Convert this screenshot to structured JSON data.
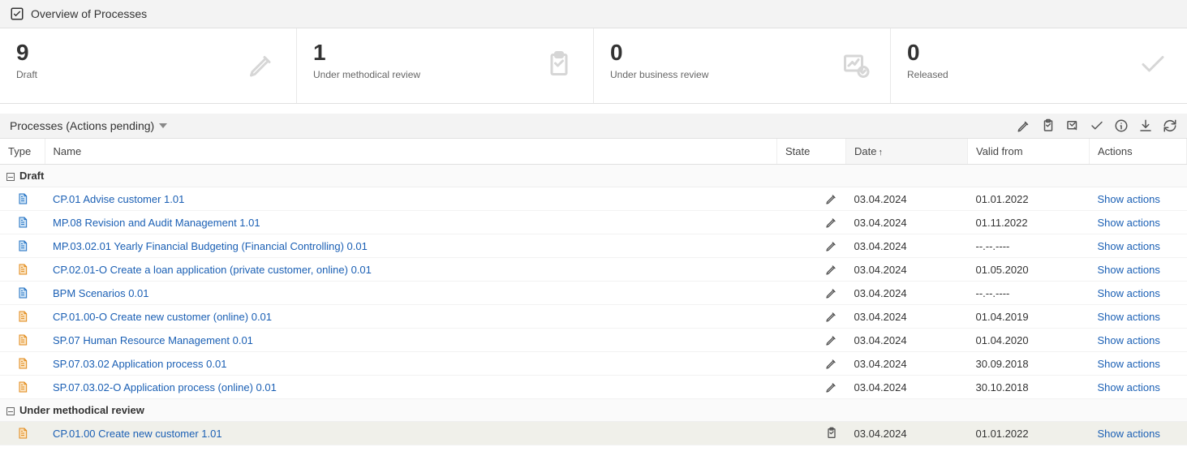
{
  "header": {
    "title": "Overview of Processes"
  },
  "cards": [
    {
      "count": "9",
      "label": "Draft",
      "icon": "pencil"
    },
    {
      "count": "1",
      "label": "Under methodical review",
      "icon": "clipboard"
    },
    {
      "count": "0",
      "label": "Under business review",
      "icon": "chart-check"
    },
    {
      "count": "0",
      "label": "Released",
      "icon": "check"
    }
  ],
  "section": {
    "title": "Processes (Actions pending)"
  },
  "toolbar_icons": [
    "pencil",
    "clipboard",
    "stamp",
    "check",
    "info",
    "download",
    "refresh"
  ],
  "columns": {
    "type": "Type",
    "name": "Name",
    "state": "State",
    "date": "Date",
    "date_sort": "↑",
    "valid_from": "Valid from",
    "actions": "Actions"
  },
  "groups": [
    {
      "label": "Draft",
      "rows": [
        {
          "type": "blue",
          "name": "CP.01 Advise customer 1.01",
          "state": "pencil",
          "date": "03.04.2024",
          "valid_from": "01.01.2022",
          "action": "Show actions"
        },
        {
          "type": "blue",
          "name": "MP.08 Revision and Audit Management 1.01",
          "state": "pencil",
          "date": "03.04.2024",
          "valid_from": "01.11.2022",
          "action": "Show actions"
        },
        {
          "type": "blue",
          "name": "MP.03.02.01 Yearly Financial Budgeting (Financial Controlling) 0.01",
          "state": "pencil",
          "date": "03.04.2024",
          "valid_from": "--.--.----",
          "action": "Show actions"
        },
        {
          "type": "orange",
          "name": "CP.02.01-O Create a loan application (private customer, online) 0.01",
          "state": "pencil",
          "date": "03.04.2024",
          "valid_from": "01.05.2020",
          "action": "Show actions"
        },
        {
          "type": "blue",
          "name": "BPM Scenarios 0.01",
          "state": "pencil",
          "date": "03.04.2024",
          "valid_from": "--.--.----",
          "action": "Show actions"
        },
        {
          "type": "orange",
          "name": "CP.01.00-O Create new customer (online) 0.01",
          "state": "pencil",
          "date": "03.04.2024",
          "valid_from": "01.04.2019",
          "action": "Show actions"
        },
        {
          "type": "orange",
          "name": "SP.07 Human Resource Management 0.01",
          "state": "pencil",
          "date": "03.04.2024",
          "valid_from": "01.04.2020",
          "action": "Show actions"
        },
        {
          "type": "orange",
          "name": "SP.07.03.02 Application process 0.01",
          "state": "pencil",
          "date": "03.04.2024",
          "valid_from": "30.09.2018",
          "action": "Show actions"
        },
        {
          "type": "orange",
          "name": "SP.07.03.02-O Application process (online) 0.01",
          "state": "pencil",
          "date": "03.04.2024",
          "valid_from": "30.10.2018",
          "action": "Show actions"
        }
      ]
    },
    {
      "label": "Under methodical review",
      "rows": [
        {
          "type": "orange",
          "name": "CP.01.00 Create new customer 1.01",
          "state": "clipboard",
          "date": "03.04.2024",
          "valid_from": "01.01.2022",
          "action": "Show actions",
          "highlight": true
        }
      ]
    }
  ]
}
